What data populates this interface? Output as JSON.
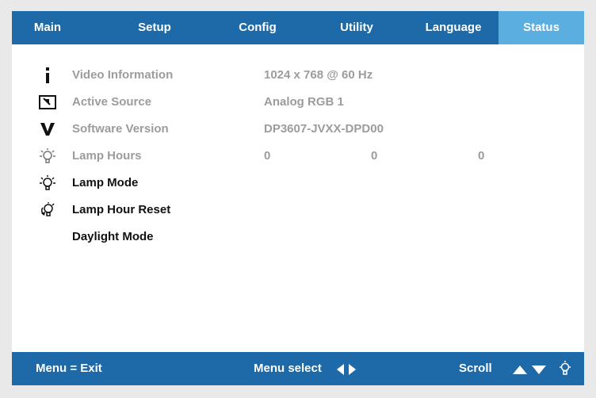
{
  "tabs": [
    {
      "label": "Main"
    },
    {
      "label": "Setup"
    },
    {
      "label": "Config"
    },
    {
      "label": "Utility"
    },
    {
      "label": "Language"
    },
    {
      "label": "Status"
    }
  ],
  "active_tab": "Status",
  "rows": {
    "video_info": {
      "label": "Video Information",
      "value": "1024  x  768  @ 60  Hz",
      "icon": "info-icon"
    },
    "active_source": {
      "label": "Active Source",
      "value": "Analog RGB 1",
      "icon": "source-icon"
    },
    "software_version": {
      "label": "Software Version",
      "value": "DP3607-JVXX-DPD00",
      "icon": "version-icon"
    },
    "lamp_hours": {
      "label": "Lamp Hours",
      "values": [
        "0",
        "0",
        "0"
      ],
      "icon": "lamp-icon"
    },
    "lamp_mode": {
      "label": "Lamp Mode",
      "icon": "lamp-icon"
    },
    "lamp_hour_reset": {
      "label": "Lamp Hour Reset",
      "icon": "lamp-reset-icon"
    },
    "daylight_mode": {
      "label": "Daylight Mode"
    }
  },
  "footer": {
    "exit": "Menu = Exit",
    "select": "Menu select",
    "scroll": "Scroll"
  },
  "colors": {
    "bar": "#1e6aa8",
    "active_tab": "#5aaee0",
    "disabled_text": "#9c9c9c",
    "text": "#111111"
  }
}
